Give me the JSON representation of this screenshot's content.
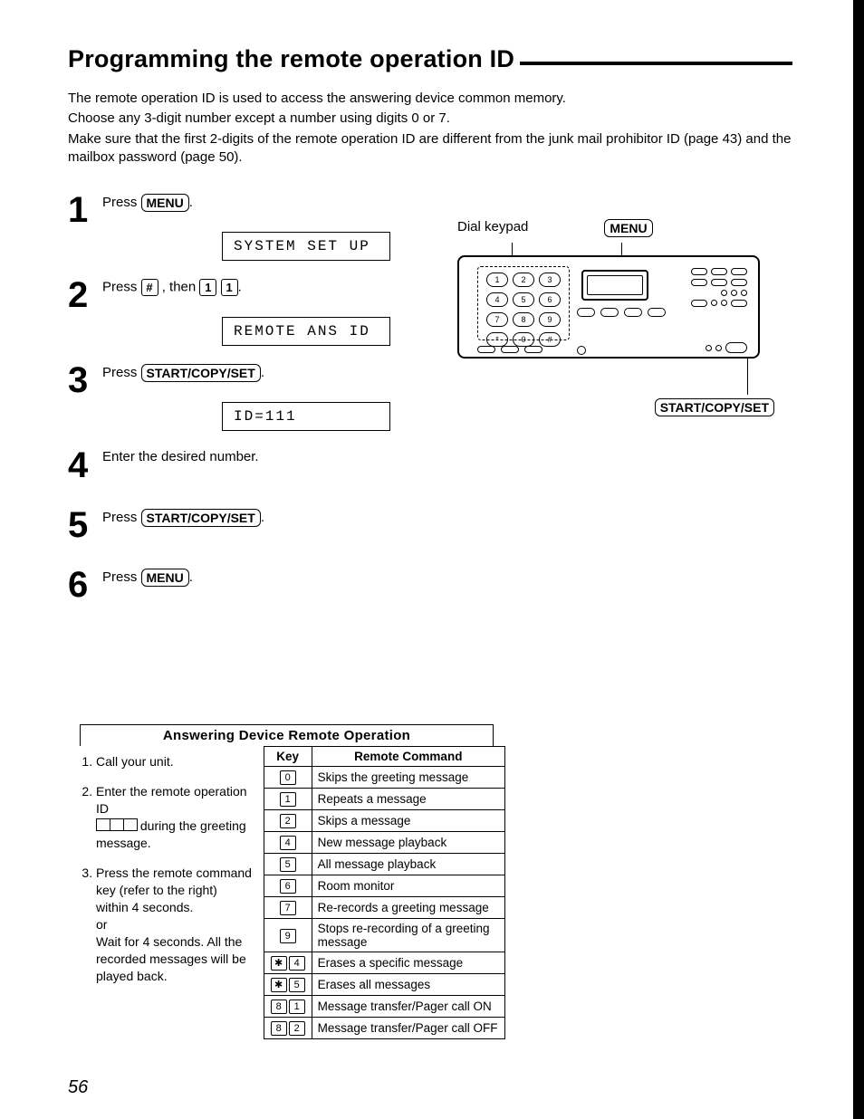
{
  "title": "Programming the remote operation ID",
  "intro": [
    "The remote operation ID is used to access the answering device common memory.",
    "Choose any 3-digit number except a number using digits 0 or 7.",
    "Make sure that the first 2-digits of the remote operation ID are different from the junk mail prohibitor ID (page 43) and the mailbox password (page 50)."
  ],
  "steps": {
    "s1": {
      "num": "1",
      "pre": "Press ",
      "key": "MENU",
      "post": ".",
      "lcd": "SYSTEM SET UP"
    },
    "s2": {
      "num": "2",
      "pre": "Press ",
      "k1": "#",
      "mid": ", then ",
      "k2": "1",
      "k3": "1",
      "post": ".",
      "lcd": "REMOTE ANS ID"
    },
    "s3": {
      "num": "3",
      "pre": "Press ",
      "key": "START/COPY/SET",
      "post": ".",
      "lcd": "ID=111"
    },
    "s4": {
      "num": "4",
      "text": "Enter the desired number."
    },
    "s5": {
      "num": "5",
      "pre": "Press ",
      "key": "START/COPY/SET",
      "post": "."
    },
    "s6": {
      "num": "6",
      "pre": "Press ",
      "key": "MENU",
      "post": "."
    }
  },
  "panel": {
    "dial_label": "Dial keypad",
    "menu_key": "MENU",
    "bottom_key": "START/COPY/SET",
    "keys": [
      "1",
      "2",
      "3",
      "4",
      "5",
      "6",
      "7",
      "8",
      "9",
      "*",
      "0",
      "#"
    ]
  },
  "card": {
    "heading": "Answering Device Remote Operation",
    "left": {
      "i1": "Call your unit.",
      "i2a": "Enter the remote operation ID",
      "i2b": " during the greeting message.",
      "i3": "Press the remote command key (refer to the right) within 4 seconds.",
      "i3or": "or",
      "i3b": "Wait for 4 seconds. All the recorded messages will be played back."
    },
    "cols": {
      "k": "Key",
      "c": "Remote Command"
    },
    "rows": [
      {
        "k": [
          "0"
        ],
        "c": "Skips the greeting message"
      },
      {
        "k": [
          "1"
        ],
        "c": "Repeats a message"
      },
      {
        "k": [
          "2"
        ],
        "c": "Skips a message"
      },
      {
        "k": [
          "4"
        ],
        "c": "New message playback"
      },
      {
        "k": [
          "5"
        ],
        "c": "All message playback"
      },
      {
        "k": [
          "6"
        ],
        "c": "Room monitor"
      },
      {
        "k": [
          "7"
        ],
        "c": "Re-records a greeting message"
      },
      {
        "k": [
          "9"
        ],
        "c": "Stops re-recording of a greeting message"
      },
      {
        "k": [
          "*",
          "4"
        ],
        "c": "Erases a specific message"
      },
      {
        "k": [
          "*",
          "5"
        ],
        "c": "Erases all messages"
      },
      {
        "k": [
          "8",
          "1"
        ],
        "c": "Message transfer/Pager call ON"
      },
      {
        "k": [
          "8",
          "2"
        ],
        "c": "Message transfer/Pager call OFF"
      }
    ]
  },
  "page_number": "56"
}
